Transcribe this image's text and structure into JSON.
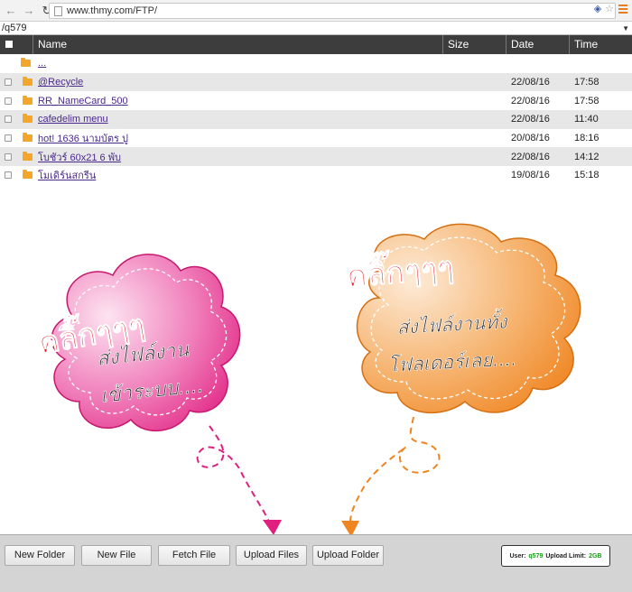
{
  "browser": {
    "url": "www.thmy.com/FTP/"
  },
  "path": "/q579",
  "table": {
    "headers": {
      "name": "Name",
      "size": "Size",
      "date": "Date",
      "time": "Time"
    },
    "rows": [
      {
        "name": "...",
        "size": "",
        "date": "",
        "time": ""
      },
      {
        "name": "@Recycle",
        "size": "",
        "date": "22/08/16",
        "time": "17:58"
      },
      {
        "name": "RR_NameCard_500",
        "size": "",
        "date": "22/08/16",
        "time": "17:58"
      },
      {
        "name": "cafedelim menu",
        "size": "",
        "date": "22/08/16",
        "time": "11:40"
      },
      {
        "name": "hot! 1636 นามบัตร ปู",
        "size": "",
        "date": "20/08/16",
        "time": "18:16"
      },
      {
        "name": "โบชัวร์ 60x21 6 พับ",
        "size": "",
        "date": "22/08/16",
        "time": "14:12"
      },
      {
        "name": "โมเดิร์นสกรีน",
        "size": "",
        "date": "19/08/16",
        "time": "15:18"
      }
    ]
  },
  "annotations": {
    "left": {
      "line1": "คลิ๊กๆๆๆ",
      "line2": "ส่งไฟล์งาน",
      "line3": "เข้าระบบ....",
      "color": "#e6338f"
    },
    "right": {
      "line1": "คลิ๊กๆๆๆ",
      "line2": "ส่งไฟล์งานทั้ง",
      "line3": "โฟลเดอร์เลย....",
      "color": "#f08a2a"
    }
  },
  "toolbar": {
    "new_folder": "New Folder",
    "new_file": "New File",
    "fetch_file": "Fetch File",
    "upload_files": "Upload Files",
    "upload_folder": "Upload Folder"
  },
  "status": {
    "user_label": "User:",
    "user_value": "q579",
    "limit_label": "Upload Limit:",
    "limit_value": "2GB"
  }
}
